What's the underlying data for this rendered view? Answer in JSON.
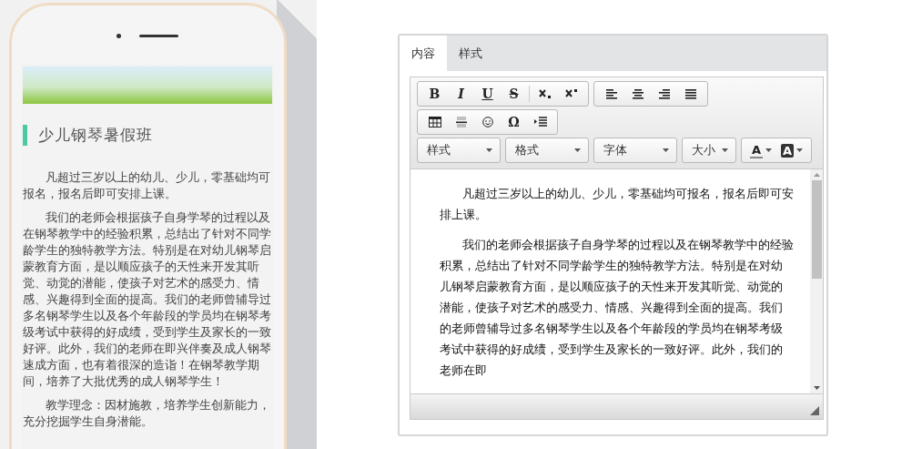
{
  "phone": {
    "title": "少儿钢琴暑假班",
    "paragraphs": [
      "凡超过三岁以上的幼儿、少儿，零基础均可报名，报名后即可安排上课。",
      "我们的老师会根据孩子自身学琴的过程以及在钢琴教学中的经验积累，总结出了针对不同学龄学生的独特教学方法。特别是在对幼儿钢琴启蒙教育方面，是以顺应孩子的天性来开发其听觉、动觉的潜能，使孩子对艺术的感受力、情感、兴趣得到全面的提高。我们的老师曾辅导过多名钢琴学生以及各个年龄段的学员均在钢琴考级考试中获得的好成绩，受到学生及家长的一致好评。此外，我们的老师在即兴伴奏及成人钢琴速成方面，也有着很深的造诣！在钢琴教学期间，培养了大批优秀的成人钢琴学生！",
      "教学理念：因材施教，培养学生创新能力，充分挖掘学生自身潜能。"
    ]
  },
  "editor": {
    "tabs": [
      {
        "label": "内容",
        "selected": true
      },
      {
        "label": "样式",
        "selected": false
      }
    ],
    "toolbar_rows": [
      [
        [
          {
            "kind": "bold",
            "label": "B"
          },
          {
            "kind": "italic",
            "label": "I"
          },
          {
            "kind": "underline",
            "label": "U"
          },
          {
            "kind": "strike",
            "label": "S"
          },
          {
            "kind": "subscript"
          },
          {
            "kind": "superscript"
          }
        ],
        [
          {
            "kind": "align-left"
          },
          {
            "kind": "align-center"
          },
          {
            "kind": "align-right"
          },
          {
            "kind": "justify"
          }
        ]
      ],
      [
        [
          {
            "kind": "table"
          },
          {
            "kind": "rule"
          },
          {
            "kind": "smiley"
          },
          {
            "kind": "omega",
            "label": "Ω"
          },
          {
            "kind": "indent"
          }
        ]
      ]
    ],
    "dropdowns": [
      "样式",
      "格式",
      "字体",
      "大小"
    ],
    "color_buttons": [
      {
        "kind": "text-color",
        "label": "A"
      },
      {
        "kind": "background-color",
        "label": "A"
      }
    ],
    "paragraphs": [
      "凡超过三岁以上的幼儿、少儿，零基础均可报名，报名后即可安排上课。",
      "我们的老师会根据孩子自身学琴的过程以及在钢琴教学中的经验积累，总结出了针对不同学龄学生的独特教学方法。特别是在对幼儿钢琴启蒙教育方面，是以顺应孩子的天性来开发其听觉、动觉的潜能，使孩子对艺术的感受力、情感、兴趣得到全面的提高。我们的老师曾辅导过多名钢琴学生以及各个年龄段的学员均在钢琴考级考试中获得的好成绩，受到学生及家长的一致好评。此外，我们的老师在即"
    ]
  }
}
